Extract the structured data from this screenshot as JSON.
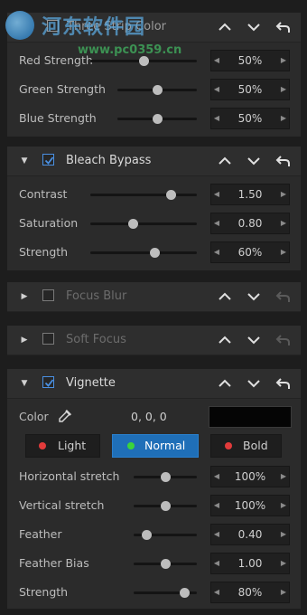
{
  "watermark": {
    "site_name": "河东软件园",
    "url": "www.pc0359.cn"
  },
  "panels": {
    "three_strip": {
      "title": "Three Strip Color",
      "rows": [
        {
          "label": "Red Strength",
          "value": "50%",
          "level": 0.5
        },
        {
          "label": "Green Strength",
          "value": "50%",
          "level": 0.5
        },
        {
          "label": "Blue Strength",
          "value": "50%",
          "level": 0.5
        }
      ]
    },
    "bleach_bypass": {
      "title": "Bleach Bypass",
      "checked": true,
      "rows": [
        {
          "label": "Contrast",
          "value": "1.50",
          "level": 0.73
        },
        {
          "label": "Saturation",
          "value": "0.80",
          "level": 0.4
        },
        {
          "label": "Strength",
          "value": "60%",
          "level": 0.6
        }
      ]
    },
    "focus_blur": {
      "title": "Focus Blur",
      "checked": false
    },
    "soft_focus": {
      "title": "Soft Focus",
      "checked": false
    },
    "vignette": {
      "title": "Vignette",
      "checked": true,
      "color_label": "Color",
      "color_value": "0, 0, 0",
      "color_swatch": "#000000",
      "modes": [
        {
          "label": "Light",
          "dot": "#e23b3b",
          "active": false
        },
        {
          "label": "Normal",
          "dot": "#3bd43b",
          "active": true
        },
        {
          "label": "Bold",
          "dot": "#e23b3b",
          "active": false
        }
      ],
      "rows": [
        {
          "label": "Horizontal stretch",
          "value": "100%",
          "level": 0.5
        },
        {
          "label": "Vertical stretch",
          "value": "100%",
          "level": 0.5
        },
        {
          "label": "Feather",
          "value": "0.40",
          "level": 0.2
        },
        {
          "label": "Feather Bias",
          "value": "1.00",
          "level": 0.5
        },
        {
          "label": "Strength",
          "value": "80%",
          "level": 0.8
        }
      ]
    }
  },
  "colors": {
    "accent": "#1f6fb8",
    "check": "#4a90e2",
    "panel_bg": "#2b2b2b",
    "app_bg": "#1d1d1d"
  },
  "icons": {
    "expand": "triangle-down-icon",
    "collapse": "triangle-right-icon",
    "move_up": "chevron-up-icon",
    "move_down": "chevron-down-icon",
    "reset": "undo-arrow-icon",
    "eyedropper": "eyedropper-icon"
  }
}
